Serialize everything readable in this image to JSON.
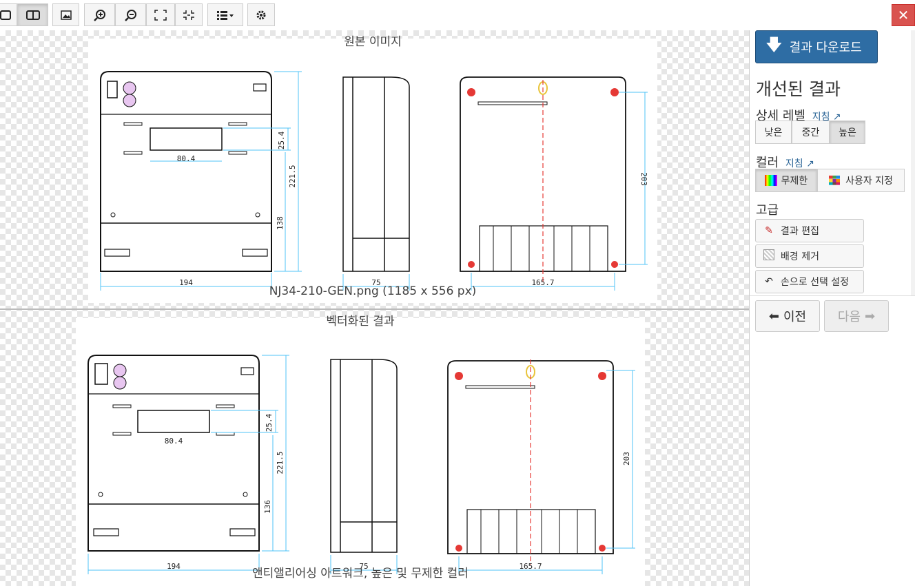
{
  "toolbar": {
    "buttons": [
      "view-single",
      "view-split",
      "view-image",
      "zoom-in",
      "zoom-out",
      "fit",
      "actual-size",
      "list-menu",
      "settings"
    ],
    "close_label": "✕"
  },
  "original": {
    "title": "원본 이미지",
    "caption": "NJ34-210-GEN.png (1185 x 556 px)"
  },
  "vectorized": {
    "title": "벡터화된 결과",
    "caption": "앤티앨리어싱 아트워크, 높은 및 무제한 컬러"
  },
  "drawing": {
    "dims": {
      "width_front": "194",
      "height_total": "221.5",
      "height_lower": "136",
      "window_w": "80.4",
      "window_h": "25.4",
      "depth": "75",
      "back_width": "165.7",
      "back_height": "203"
    },
    "orig_lower": "138"
  },
  "sidebar": {
    "download_label": "결과 다운로드",
    "heading": "개선된 결과",
    "detail_label": "상세 레벨",
    "detail_guide": "지침",
    "detail_options": [
      "낮은",
      "중간",
      "높은"
    ],
    "detail_selected": "높은",
    "color_label": "컬러",
    "color_guide": "지침",
    "color_options": [
      "무제한",
      "사용자 지정"
    ],
    "color_selected": "무제한",
    "advanced_label": "고급",
    "edit_label": "결과 편집",
    "bg_remove_label": "배경 제거",
    "manual_label": "손으로 선택 설정",
    "prev_label": "이전",
    "next_label": "다음"
  },
  "colors": {
    "accent": "#2e6da4",
    "close": "#d9534f",
    "dimension": "#4fc3f7",
    "centerline": "#e53935"
  }
}
